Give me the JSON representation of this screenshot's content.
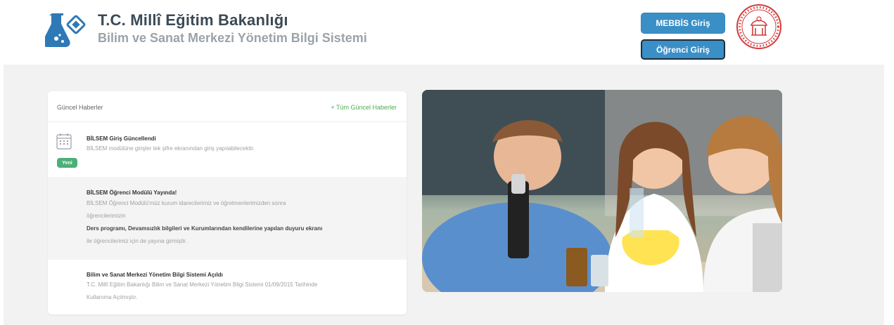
{
  "header": {
    "title": "T.C. Millî Eğitim Bakanlığı",
    "subtitle": "Bilim ve Sanat Merkezi Yönetim Bilgi Sistemi",
    "buttons": {
      "mebbis": "MEBBİS Giriş",
      "ogrenci": "Öğrenci Giriş"
    },
    "colors": {
      "button": "#3a8fc6",
      "title": "#3b4a55",
      "subtitle": "#9aa3aa"
    }
  },
  "news": {
    "header_title": "Güncel Haberler",
    "all_link": "+ Tüm Güncel Haberler",
    "items": [
      {
        "title": "BİLSEM Giriş Güncellendi",
        "text": "BİLSEM modülüne girişler tek şifre ekranından giriş yapılabilecektir.",
        "badge": "Yeni",
        "icon": "calendar-icon"
      },
      {
        "title": "BİLSEM Öğrenci Modülü Yayında!",
        "text_line1": "BİLSEM Öğrenci Modülü'müz kurum idarecilerimiz ve öğretmenlerimizden sonra",
        "text_line2": "öğrencilerimizin",
        "text_bold": "Ders programı, Devamsızlık bilgileri ve Kurumlarından kendilerine yapılan duyuru ekranı",
        "text_line3": "ile öğrencilerimiz için de yayına girmiştir."
      },
      {
        "title": "Bilim ve Sanat Merkezi Yönetim Bilgi Sistemi Açıldı",
        "text_line1": "T.C. Millî Eğitim Bakanlığı Bilim ve Sanat Merkezi Yönetim Bilgi Sistemi 01/09/2015 Tarihinde",
        "text_line2": "Kullanıma Açılmıştır."
      }
    ],
    "colors": {
      "badge": "#4caf78",
      "link": "#4caf50"
    }
  },
  "hero": {
    "alt": "children-science-image"
  }
}
